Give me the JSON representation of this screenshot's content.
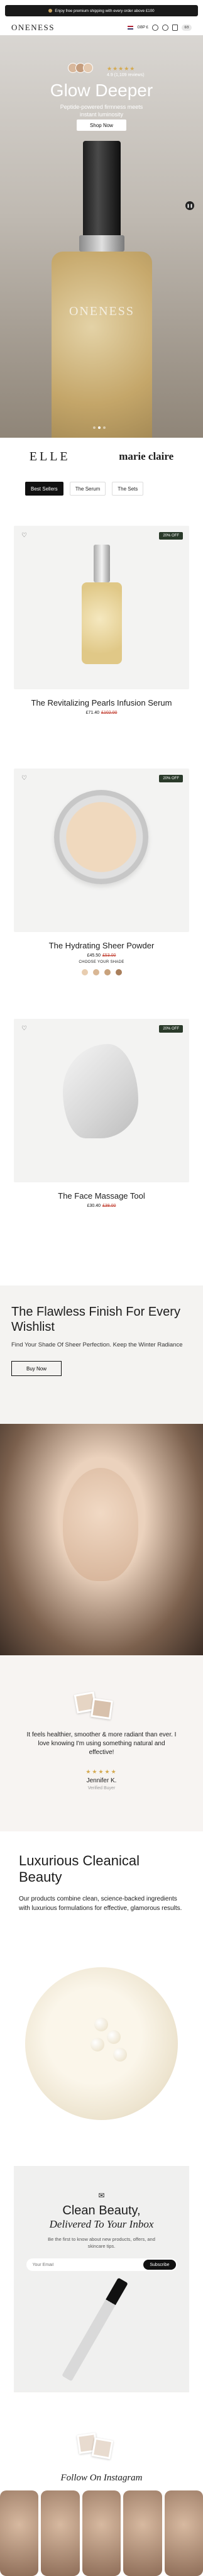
{
  "announcement": {
    "text": "Enjoy free premium shipping with every order above £100"
  },
  "header": {
    "logo": "ONENESS",
    "currency": "GBP £",
    "account_badge": "0/3"
  },
  "hero": {
    "rating_stars": "★★★★★",
    "rating_text": "4.9 (1,109 reviews)",
    "headline": "Glow Deeper",
    "subheadline": "Peptide-powered firmness meets instant luminosity",
    "cta": "Shop Now",
    "bottle_brand": "ONENESS",
    "slides": 3,
    "active_slide": 1
  },
  "press": {
    "logo1": "ELLE",
    "logo2": "marie claire"
  },
  "tabs": [
    {
      "label": "Best Sellers",
      "active": true
    },
    {
      "label": "The Serum"
    },
    {
      "label": "The Sets"
    }
  ],
  "products": [
    {
      "badge": "20% OFF",
      "title": "The Revitalizing Pearls Infusion Serum",
      "price": "£71.40",
      "was": "£102.00"
    },
    {
      "badge": "20% OFF",
      "title": "The Hydrating Sheer Powder",
      "price": "£45.50",
      "was": "£53.00",
      "shade_label": "CHOOSE YOUR SHADE",
      "shades": [
        "#e8cdb0",
        "#d9b794",
        "#c8a27c",
        "#a97f5c"
      ]
    },
    {
      "badge": "20% OFF",
      "title": "The Face Massage Tool",
      "price": "£30.40",
      "was": "£38.00"
    }
  ],
  "flawless": {
    "title": "The Flawless Finish For Every Wishlist",
    "body": "Find Your Shade Of Sheer Perfection. Keep the Winter Radiance",
    "cta": "Buy Now"
  },
  "testimonial": {
    "quote": "It feels healthier, smoother & more radiant than ever. I love knowing I'm using something natural and effective!",
    "stars": "★★★★★",
    "name": "Jennifer K.",
    "verified": "Verified Buyer"
  },
  "luxurious": {
    "title": "Luxurious Cleanical Beauty",
    "body": "Our products combine clean, science-backed ingredients with luxurious formulations for effective, glamorous results."
  },
  "newsletter": {
    "title": "Clean Beauty,",
    "subtitle": "Delivered To Your Inbox",
    "body": "Be the first to know about new products, offers, and skincare tips.",
    "placeholder": "Your Email",
    "cta": "Subscribe"
  },
  "instagram": {
    "title": "Follow On Instagram"
  },
  "colors": {
    "accent": "#111111",
    "star": "#d4a94f",
    "sale": "#c0392b",
    "badge": "#2a3a2a"
  }
}
